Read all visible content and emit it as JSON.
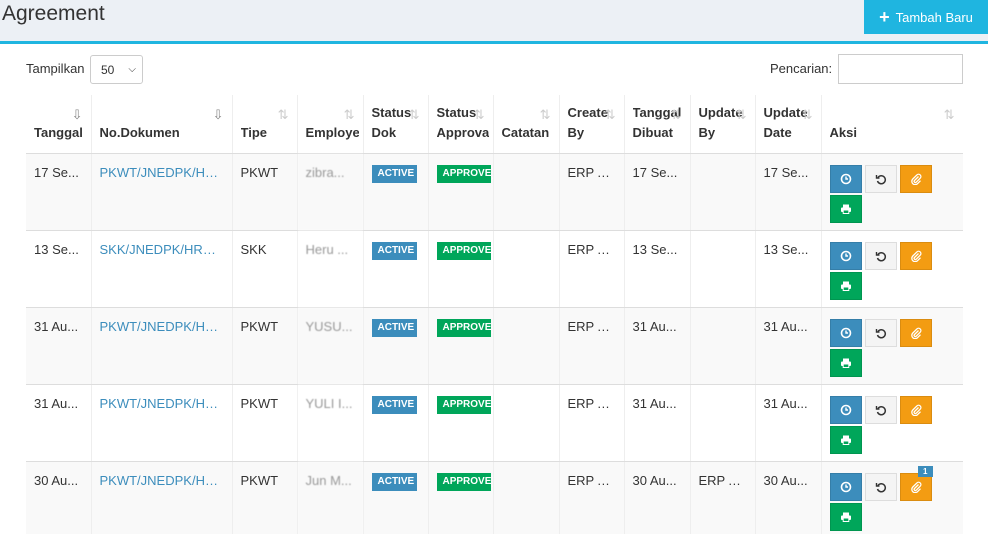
{
  "header": {
    "title": "Agreement",
    "add_button": "Tambah Baru"
  },
  "controls": {
    "length_label": "Tampilkan",
    "length_value": "50",
    "search_label": "Pencarian:",
    "search_value": ""
  },
  "table": {
    "columns": [
      {
        "line1": "",
        "line2": "Tanggal"
      },
      {
        "line1": "",
        "line2": "No.Dokumen"
      },
      {
        "line1": "",
        "line2": "Tipe"
      },
      {
        "line1": "",
        "line2": "Employee"
      },
      {
        "line1": "Status",
        "line2": "Dok"
      },
      {
        "line1": "Status",
        "line2": "Approval"
      },
      {
        "line1": "",
        "line2": "Catatan"
      },
      {
        "line1": "Create",
        "line2": "By"
      },
      {
        "line1": "Tanggal",
        "line2": "Dibuat"
      },
      {
        "line1": "Update",
        "line2": "By"
      },
      {
        "line1": "Update",
        "line2": "Date"
      },
      {
        "line1": "",
        "line2": "Aksi"
      }
    ],
    "rows": [
      {
        "tanggal": "17 Se...",
        "dokumen": "PKWT/JNEDPK/HR...",
        "tipe": "PKWT",
        "employee": "zibra...",
        "status_dok": "ACTIVE",
        "status_approval": "APPROVED",
        "catatan": "",
        "create_by": "ERP A...",
        "tanggal_dibuat": "17 Se...",
        "update_by": "",
        "update_date": "17 Se...",
        "badge": ""
      },
      {
        "tanggal": "13 Se...",
        "dokumen": "SKK/JNEDPK/HRD-...",
        "tipe": "SKK",
        "employee": "Heru ...",
        "status_dok": "ACTIVE",
        "status_approval": "APPROVED",
        "catatan": "",
        "create_by": "ERP A...",
        "tanggal_dibuat": "13 Se...",
        "update_by": "",
        "update_date": "13 Se...",
        "badge": ""
      },
      {
        "tanggal": "31 Au...",
        "dokumen": "PKWT/JNEDPK/HR...",
        "tipe": "PKWT",
        "employee": "YUSU...",
        "status_dok": "ACTIVE",
        "status_approval": "APPROVED",
        "catatan": "",
        "create_by": "ERP A...",
        "tanggal_dibuat": "31 Au...",
        "update_by": "",
        "update_date": "31 Au...",
        "badge": ""
      },
      {
        "tanggal": "31 Au...",
        "dokumen": "PKWT/JNEDPK/HR...",
        "tipe": "PKWT",
        "employee": "YULI I...",
        "status_dok": "ACTIVE",
        "status_approval": "APPROVED",
        "catatan": "",
        "create_by": "ERP A...",
        "tanggal_dibuat": "31 Au...",
        "update_by": "",
        "update_date": "31 Au...",
        "badge": ""
      },
      {
        "tanggal": "30 Au...",
        "dokumen": "PKWT/JNEDPK/HR...",
        "tipe": "PKWT",
        "employee": "Jun M...",
        "status_dok": "ACTIVE",
        "status_approval": "APPROVED",
        "catatan": "",
        "create_by": "ERP A...",
        "tanggal_dibuat": "30 Au...",
        "update_by": "ERP A...",
        "update_date": "30 Au...",
        "badge": "1"
      }
    ]
  },
  "colors": {
    "accent": "#1fb5e0",
    "primary": "#3c8dbc",
    "success": "#00a65a",
    "warning": "#f39c12"
  },
  "icons": {
    "add": "plus-icon",
    "history": "clock-icon",
    "revert": "undo-icon",
    "attach": "paperclip-icon",
    "print": "print-icon"
  }
}
